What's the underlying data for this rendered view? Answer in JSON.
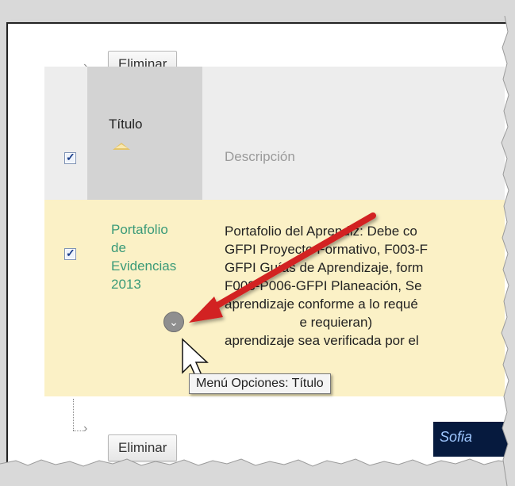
{
  "toolbar_top": {
    "delete_label": "Eliminar"
  },
  "toolbar_bottom": {
    "delete_label": "Eliminar"
  },
  "table": {
    "headers": {
      "title": "Título",
      "description": "Descripción"
    },
    "rows": [
      {
        "title_lines": [
          "Portafolio",
          "de",
          "Evidencias",
          "2013"
        ],
        "description_lines": [
          "Portafolio del Aprendiz: Debe co",
          "GFPI Proyecto Formativo, F003-F",
          "GFPI Guías de Aprendizaje, form",
          "F008-P006-GFPI Planeación, Se",
          "aprendizaje conforme a lo requé",
          "                    e requieran)",
          "aprendizaje sea verificada por el"
        ],
        "checked": true
      }
    ]
  },
  "tooltip": "Menú Opciones: Título",
  "logo_text": "Sofia",
  "colors": {
    "arrow": "#d22020",
    "title_link": "#3a9a78",
    "row_bg": "#fbf1c6"
  }
}
